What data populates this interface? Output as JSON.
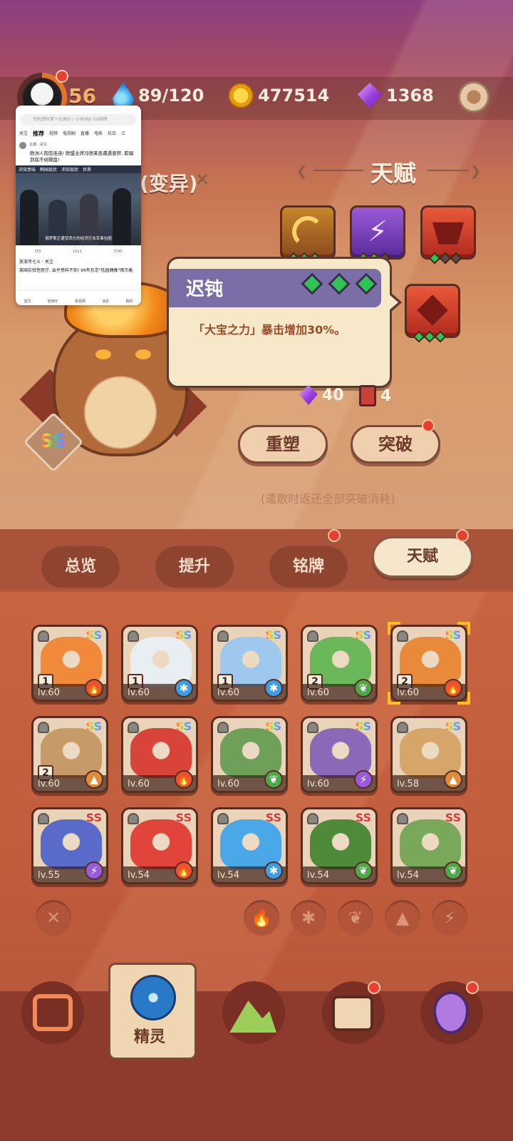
{
  "header": {
    "level": "56",
    "energy": "89/120",
    "coins": "477514",
    "gems": "1368"
  },
  "feed_overlay": {
    "search_placeholder": "司机感叹萝卜征高价 | 小米MIJI Go接棒",
    "tabs": [
      "关注",
      "推荐",
      "视频",
      "电视剧",
      "直播",
      "电影",
      "抗日",
      "三"
    ],
    "active_tab": "推荐",
    "post_author": "主播 · 关注",
    "post_title": "欧洲人抱怨连连! 欧盟主席冯德莱恩遭遇查禁, 欺骗到底不给脚盘!",
    "image_tags": [
      "冲突意味",
      "韩国现状",
      "冲突现状",
      "世界"
    ],
    "image_caption": "俄罗斯正遭受西方的经济打击军事包围",
    "actions": [
      "355",
      "1011",
      "3745"
    ],
    "post2_author": "放浪传七斗 · 关注",
    "post2_title": "某国实验性医疗, 出乎意料不到! 96年东京\"低园偶像\"暗示着",
    "nav": [
      "首页",
      "放映厅",
      "发视频",
      "消息",
      "我的"
    ]
  },
  "character": {
    "variant_label": "(变异)",
    "grade": "SS"
  },
  "talent": {
    "title": "天赋",
    "tooltip": {
      "name": "迟钝",
      "description": "「大宝之力」暴击增加30%。",
      "level": 3
    },
    "cost_gems": "40",
    "cost_books": "4",
    "reshape_label": "重塑",
    "breakthrough_label": "突破",
    "hint": "(遣散时返还全部突破消耗)"
  },
  "tabs": [
    {
      "label": "总览",
      "active": false
    },
    {
      "label": "提升",
      "active": false
    },
    {
      "label": "铭牌",
      "active": false
    },
    {
      "label": "天赋",
      "active": true
    }
  ],
  "pets": [
    {
      "grade": "SS",
      "level": "lv.60",
      "star": "1",
      "element": "fire",
      "color": "#f08a3a",
      "selected": false
    },
    {
      "grade": "SS",
      "level": "lv.60",
      "star": "1",
      "element": "ice",
      "color": "#e8eef2",
      "selected": false
    },
    {
      "grade": "SS",
      "level": "lv.60",
      "star": "1",
      "element": "ice",
      "color": "#9fc8ef",
      "selected": false
    },
    {
      "grade": "SS",
      "level": "lv.60",
      "star": "2",
      "element": "leaf",
      "color": "#6ab85a",
      "selected": false
    },
    {
      "grade": "SS",
      "level": "lv.60",
      "star": "2",
      "element": "fire",
      "color": "#e88a3a",
      "selected": true
    },
    {
      "grade": "SS",
      "level": "lv.60",
      "star": "2",
      "element": "earth",
      "color": "#c79a6a",
      "selected": false
    },
    {
      "grade": "SS",
      "level": "lv.60",
      "star": "",
      "element": "fire",
      "color": "#d8443a",
      "selected": false
    },
    {
      "grade": "SS",
      "level": "lv.60",
      "star": "",
      "element": "leaf",
      "color": "#6fa05a",
      "selected": false
    },
    {
      "grade": "SS",
      "level": "lv.60",
      "star": "",
      "element": "thunder",
      "color": "#8a6ab8",
      "selected": false
    },
    {
      "grade": "SS",
      "level": "lv.58",
      "star": "",
      "element": "earth",
      "color": "#d6a56a",
      "selected": false
    },
    {
      "grade": "SS",
      "level": "lv.55",
      "star": "",
      "element": "thunder",
      "color": "#5a6ac8",
      "selected": false
    },
    {
      "grade": "SS",
      "level": "lv.54",
      "star": "",
      "element": "fire",
      "color": "#e0443a",
      "selected": false
    },
    {
      "grade": "SS",
      "level": "lv.54",
      "star": "",
      "element": "ice",
      "color": "#4aa8e8",
      "selected": false
    },
    {
      "grade": "SS",
      "level": "lv.54",
      "star": "",
      "element": "leaf",
      "color": "#4f8a3a",
      "selected": false
    },
    {
      "grade": "SS",
      "level": "lv.54",
      "star": "",
      "element": "leaf",
      "color": "#7aa85a",
      "selected": false
    }
  ],
  "filters": [
    "clear",
    "fire",
    "ice",
    "leaf",
    "earth",
    "thunder"
  ],
  "bottom_nav": {
    "active_label": "精灵",
    "items": [
      "backpack-icon",
      "spirit-icon",
      "mountain-icon",
      "chest-icon",
      "map-pin-icon"
    ]
  }
}
